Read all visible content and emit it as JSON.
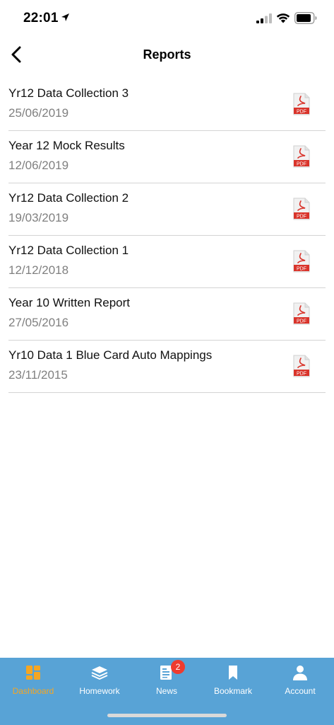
{
  "status_bar": {
    "time": "22:01"
  },
  "nav": {
    "title": "Reports"
  },
  "reports": [
    {
      "title": "Yr12 Data Collection 3",
      "date": "25/06/2019",
      "file_label": "PDF"
    },
    {
      "title": "Year 12 Mock Results",
      "date": "12/06/2019",
      "file_label": "PDF"
    },
    {
      "title": "Yr12 Data Collection 2",
      "date": "19/03/2019",
      "file_label": "PDF"
    },
    {
      "title": "Yr12 Data Collection 1",
      "date": "12/12/2018",
      "file_label": "PDF"
    },
    {
      "title": "Year 10 Written Report",
      "date": "27/05/2016",
      "file_label": "PDF"
    },
    {
      "title": "Yr10 Data 1 Blue Card Auto Mappings",
      "date": "23/11/2015",
      "file_label": "PDF"
    }
  ],
  "tab_bar": {
    "tabs": [
      {
        "label": "Dashboard",
        "icon": "dashboard-icon",
        "active": true
      },
      {
        "label": "Homework",
        "icon": "homework-stack-icon",
        "active": false
      },
      {
        "label": "News",
        "icon": "news-icon",
        "active": false,
        "badge": "2"
      },
      {
        "label": "Bookmark",
        "icon": "bookmark-icon",
        "active": false
      },
      {
        "label": "Account",
        "icon": "account-icon",
        "active": false
      }
    ]
  },
  "colors": {
    "tab_bar_bg": "#58a3d6",
    "active_tab": "#f5a623",
    "badge": "#ee3b2f",
    "pdf_red": "#d9342b"
  }
}
